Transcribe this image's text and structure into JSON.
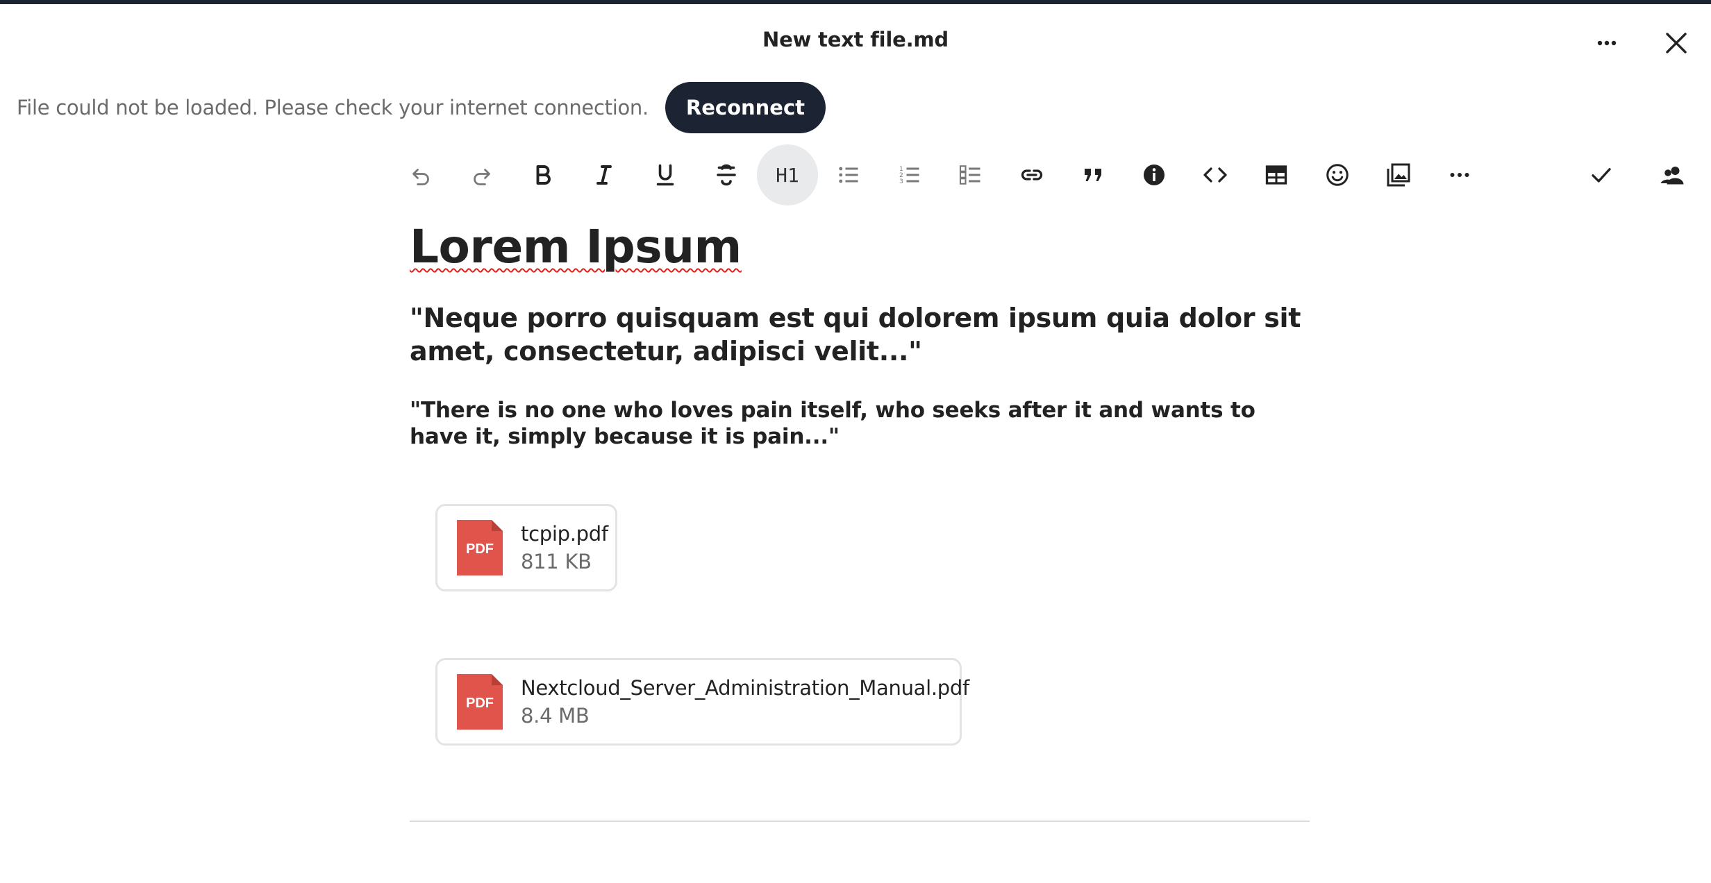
{
  "header": {
    "title": "New text file.md",
    "more_icon": "more-horizontal-icon",
    "close_icon": "close-icon"
  },
  "connection": {
    "error_message": "File could not be loaded. Please check your internet connection.",
    "reconnect_label": "Reconnect"
  },
  "toolbar": {
    "items": [
      "undo-icon",
      "redo-icon",
      "bold-icon",
      "italic-icon",
      "underline-icon",
      "strikethrough-icon",
      "heading-icon",
      "bullet-list-icon",
      "numbered-list-icon",
      "checklist-icon",
      "link-icon",
      "blockquote-icon",
      "callout-info-icon",
      "code-block-icon",
      "table-icon",
      "emoji-icon",
      "insert-image-icon",
      "more-formatting-icon",
      "saved-check-icon",
      "collaborators-icon"
    ],
    "heading_label": "H1"
  },
  "document": {
    "heading": "Lorem Ipsum",
    "quote_latin": "\"Neque porro quisquam est qui dolorem ipsum quia dolor sit amet, consectetur, adipisci velit...\"",
    "quote_english": "\"There is no one who loves pain itself, who seeks after it and wants to have it, simply because it is pain...\""
  },
  "attachments": [
    {
      "name": "tcpip.pdf",
      "size": "811 KB",
      "icon_label": "PDF"
    },
    {
      "name": "Nextcloud_Server_Administration_Manual.pdf",
      "size": "8.4 MB",
      "icon_label": "PDF"
    }
  ],
  "colors": {
    "accent_dark": "#1c2434",
    "pdf_red": "#e0544b",
    "spellcheck": "#e0201b"
  }
}
